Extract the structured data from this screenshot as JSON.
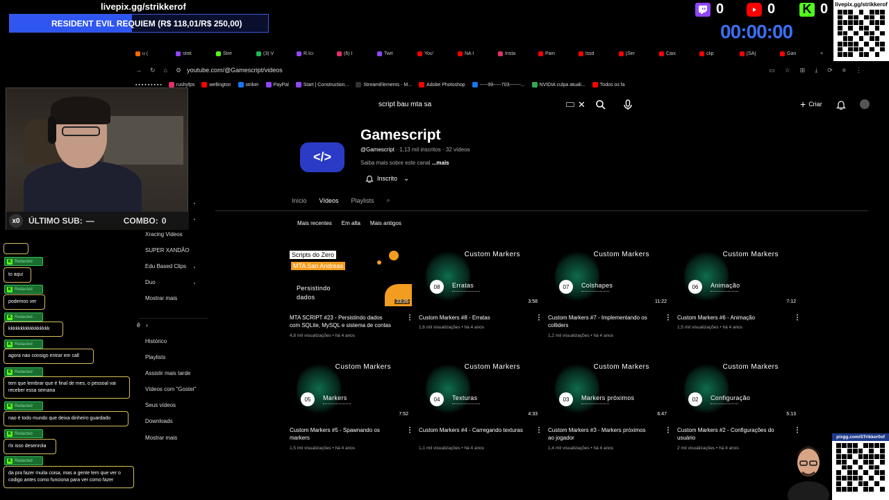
{
  "overlay": {
    "donate_url": "livepix.gg/strikkerof",
    "donate_goal": "RESIDENT EVIL REQUIEM (R$ 118,01/R$ 250,00)",
    "donate_progress": 0.472,
    "twitch_count": "0",
    "youtube_count": "0",
    "kick_count": "0",
    "timer": "00:00:00",
    "qr_top_url": "livepix.gg/strikkerof",
    "qr_bottom_url": "pixgg.com/STrikker0of",
    "last_sub_label": "ÚLTIMO SUB:",
    "last_sub_value": "—",
    "combo_label": "COMBO:",
    "combo_value": "0",
    "multiplier": "x0"
  },
  "browser": {
    "tabs": [
      "u (",
      "strik",
      "Stre",
      "(3) V",
      "R.Ici",
      "(6) I",
      "Twit",
      "You'",
      "NA I",
      "Insta",
      "Pain",
      "lssd",
      "[Ser",
      "Caix",
      "clip",
      "[SA]",
      "Gan"
    ],
    "url": "youtube.com/@Gamescript/videos",
    "bookmarks": [
      "rushyfps",
      "wellington",
      "striker",
      "PayPal",
      "Start | Construction...",
      "StreamElements - M...",
      "Adobe Photoshop",
      "-----99-----703-------...",
      "NVIDIA culpa atuali...",
      "Todos os fa"
    ]
  },
  "youtube": {
    "search_query": "script bau mta sa",
    "create_label": "Criar",
    "channel": {
      "avatar_text": "</>",
      "name": "Gamescript",
      "handle": "@Gamescript",
      "meta_rest": " · 1,13 mil inscritos · 32 vídeos",
      "about": "Saiba mais sobre este canal",
      "about_more": " ...mais",
      "subscribed_label": "Inscrito"
    },
    "tabs": [
      "Início",
      "Vídeos",
      "Playlists"
    ],
    "active_tab": "Vídeos",
    "chips": [
      "Mais recentes",
      "Em alta",
      "Mais antigos"
    ],
    "sidebar_top": [
      "Xracing Videos",
      "SUPER XANDÃO",
      "Edu Based Clips",
      "Duo",
      "Mostrar mais"
    ],
    "you_label": "ê",
    "sidebar_you": [
      "Histórico",
      "Playlists",
      "Assistir mais tarde",
      "Vídeos com \"Gostei\"",
      "Seus vídeos",
      "Downloads",
      "Mostrar mais"
    ],
    "videos": [
      {
        "thumb_title": "",
        "num": "",
        "label": "Persistindo dados",
        "duration": "23:26",
        "title": "MTA SCRIPT #23 - Persistindo dados com SQLite, MySQL e sistema de contas",
        "meta": "4,8 mil visualizações • há 4 anos",
        "tag1": "Scripts do Zero",
        "tag2": "MTA San Andreas"
      },
      {
        "thumb_title": "Custom Markers",
        "num": "08",
        "label": "Erratas",
        "duration": "3:58",
        "title": "Custom Markers #8 - Erratas",
        "meta": "1,6 mil visualizações • há 4 anos"
      },
      {
        "thumb_title": "Custom Markers",
        "num": "07",
        "label": "Colshapes",
        "duration": "11:22",
        "title": "Custom Markers #7 - Implementando os colliders",
        "meta": "1,2 mil visualizações • há 4 anos"
      },
      {
        "thumb_title": "Custom Markers",
        "num": "06",
        "label": "Animação",
        "duration": "7:12",
        "title": "Custom Markers #6 - Animação",
        "meta": "1,5 mil visualizações • há 4 anos"
      },
      {
        "thumb_title": "Custom Markers",
        "num": "05",
        "label": "Markers",
        "duration": "7:52",
        "title": "Custom Markers #5 - Spawnando os markers",
        "meta": "1,5 mil visualizações • há 4 anos"
      },
      {
        "thumb_title": "Custom Markers",
        "num": "04",
        "label": "Texturas",
        "duration": "4:33",
        "title": "Custom Markers #4 - Carregando texturas",
        "meta": "1,1 mil visualizações • há 4 anos"
      },
      {
        "thumb_title": "Custom Markers",
        "num": "03",
        "label": "Markers próximos",
        "duration": "6:47",
        "title": "Custom Markers #3 - Markers próximos ao jogador",
        "meta": "1,4 mil visualizações • há 4 anos"
      },
      {
        "thumb_title": "Custom Markers",
        "num": "02",
        "label": "Configuração",
        "duration": "5:13",
        "title": "Custom Markers #2 - Configurações do usuário",
        "meta": "2 mil visualizações • há 4 anos"
      }
    ]
  },
  "chat": {
    "badge_user": "Redacted",
    "messages": [
      "to aqui",
      "podemos ver",
      "kkkkkkkkkkkkkkkkk",
      "agora nao consigo entrar em call",
      "tem que lembrar que é final de mes, o pessoal vai receber essa semana",
      "nao é todo mundo que deixa dinheiro guardado",
      "rlx isso desenrola",
      "da pra fazer muita coisa, mas a gente tem que ver o codigo antes como funciona para ver como fazer"
    ]
  },
  "colors": {
    "accent_blue": "#3c6df0",
    "kick_green": "#53fc18",
    "youtube_red": "#ff0000",
    "twitch_purple": "#9146ff"
  }
}
